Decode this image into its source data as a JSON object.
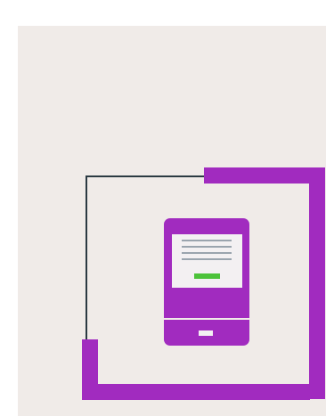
{
  "colors": {
    "background": "#ffffff",
    "panel": "#f0ebe8",
    "accent": "#a12bbf",
    "line": "#2b3a42",
    "screen": "#f3f0f2",
    "screen_lines": "#7c8a98",
    "confirm_bar": "#4cc23a"
  },
  "icons": {
    "device": "tablet-kiosk-icon"
  }
}
